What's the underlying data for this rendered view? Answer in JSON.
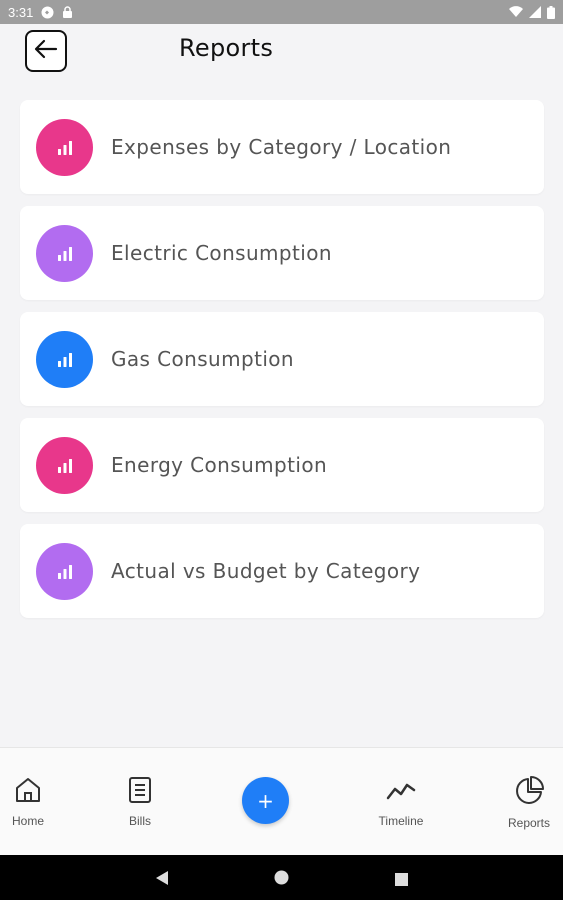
{
  "status_bar": {
    "time": "3:31",
    "icons": [
      "notification-icon",
      "lock-icon",
      "wifi-icon",
      "signal-icon",
      "battery-icon"
    ]
  },
  "header": {
    "title": "Reports",
    "back_icon": "arrow-left-icon"
  },
  "reports": [
    {
      "label": "Expenses by Category / Location",
      "color": "#e8378b",
      "icon": "bar-chart-icon"
    },
    {
      "label": "Electric Consumption",
      "color": "#b26cf0",
      "icon": "bar-chart-icon"
    },
    {
      "label": "Gas Consumption",
      "color": "#1f7ef7",
      "icon": "bar-chart-icon"
    },
    {
      "label": "Energy Consumption",
      "color": "#e8378b",
      "icon": "bar-chart-icon"
    },
    {
      "label": "Actual vs Budget by Category",
      "color": "#b26cf0",
      "icon": "bar-chart-icon"
    }
  ],
  "bottom_nav": {
    "items": [
      {
        "label": "Home",
        "icon": "home-icon"
      },
      {
        "label": "Bills",
        "icon": "document-icon"
      },
      {
        "label": "Timeline",
        "icon": "trend-line-icon"
      },
      {
        "label": "Reports",
        "icon": "pie-chart-icon"
      }
    ],
    "fab_label": "+",
    "fab_color": "#1f7ef7"
  },
  "system_nav": {
    "icons": [
      "back-triangle-icon",
      "home-circle-icon",
      "recents-square-icon"
    ]
  }
}
